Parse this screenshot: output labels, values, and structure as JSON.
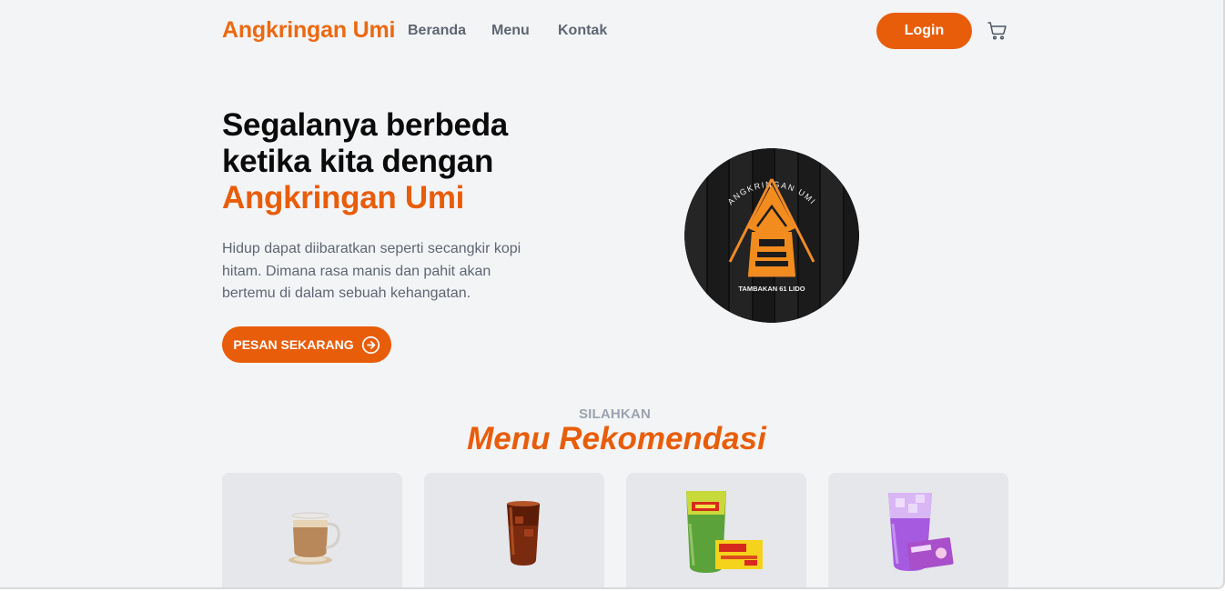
{
  "navbar": {
    "brand": "Angkringan Umi",
    "links": [
      "Beranda",
      "Menu",
      "Kontak"
    ],
    "login_label": "Login",
    "cart_icon": "cart-icon"
  },
  "hero": {
    "title_line1": "Segalanya berbeda",
    "title_line2": "ketika kita dengan",
    "title_accent": "Angkringan Umi",
    "description": "Hidup dapat diibaratkan seperti secangkir kopi hitam. Dimana rasa manis dan pahit akan bertemu di dalam sebuah kehangatan.",
    "cta_label": "PESAN SEKARANG",
    "cta_icon": "arrow-right-circle-icon"
  },
  "logo": {
    "arc_text": "ANGKRINGAN UMI",
    "bottom_text": "TAMBAKAN 61 LIDO"
  },
  "recommendations": {
    "kicker": "SILAHKAN",
    "title": "Menu Rekomendasi",
    "items": [
      {
        "image": "coffee-with-milk-cup"
      },
      {
        "image": "iced-tea-glass"
      },
      {
        "image": "extra-joss-green-drink"
      },
      {
        "image": "purple-taro-ice-drink"
      }
    ]
  },
  "colors": {
    "accent": "#e85d0a",
    "brand": "#ea6a12",
    "background": "#f3f4f6",
    "card": "#e5e7eb",
    "muted_text": "#5f6672"
  }
}
